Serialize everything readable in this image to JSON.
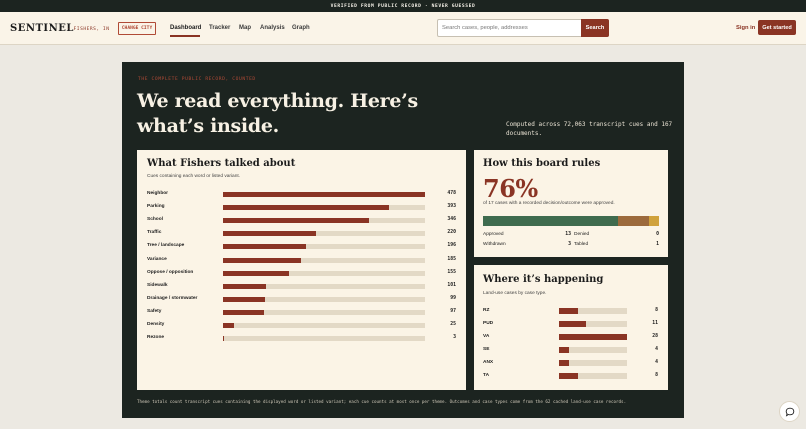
{
  "topbar": {
    "text": "VERIFIED FROM PUBLIC RECORD · NEVER GUESSED"
  },
  "header": {
    "brand": "SENTINEL",
    "city": "· FISHERS, IN",
    "change_city": "CHANGE CITY",
    "nav": [
      "Dashboard",
      "Tracker",
      "Map",
      "Analysis",
      "Graph"
    ],
    "active_nav": "Dashboard",
    "search_placeholder": "Search cases, people, addresses",
    "search_button": "Search",
    "sign_in": "Sign in",
    "get_started": "Get started"
  },
  "hero": {
    "eyebrow": "THE COMPLETE PUBLIC RECORD, COUNTED",
    "title": "We read everything. Here’s what’s inside.",
    "subtitle": "Computed across 72,063 transcript cues and 167 documents."
  },
  "topics": {
    "title": "What Fishers talked about",
    "subtitle": "Cues containing each word or listed variant.",
    "max": 478,
    "items": [
      {
        "label": "Neighbor",
        "value": 478
      },
      {
        "label": "Parking",
        "value": 393
      },
      {
        "label": "School",
        "value": 346
      },
      {
        "label": "Traffic",
        "value": 220
      },
      {
        "label": "Tree / landscape",
        "value": 196
      },
      {
        "label": "Variance",
        "value": 185
      },
      {
        "label": "Oppose / opposition",
        "value": 155
      },
      {
        "label": "Sidewalk",
        "value": 101
      },
      {
        "label": "Drainage / stormwater",
        "value": 99
      },
      {
        "label": "Safety",
        "value": 97
      },
      {
        "label": "Density",
        "value": 25
      },
      {
        "label": "Rezone",
        "value": 3
      }
    ]
  },
  "rules": {
    "title": "How this board rules",
    "percent": "76%",
    "subtitle": "of 17 cases with a recorded decision/outcome were approved.",
    "outcomes": [
      {
        "label": "Approved",
        "value": 13,
        "color": "#3f6b4e"
      },
      {
        "label": "Denied",
        "value": 0,
        "color": "#8a3424"
      },
      {
        "label": "Withdrawn",
        "value": 3,
        "color": "#9c6a3c"
      },
      {
        "label": "Tabled",
        "value": 1,
        "color": "#d0a23c"
      }
    ]
  },
  "where": {
    "title": "Where it’s happening",
    "subtitle": "Land-use cases by case type.",
    "max": 28,
    "items": [
      {
        "label": "RZ",
        "value": 8
      },
      {
        "label": "PUD",
        "value": 11
      },
      {
        "label": "VA",
        "value": 28
      },
      {
        "label": "SE",
        "value": 4
      },
      {
        "label": "ANX",
        "value": 4
      },
      {
        "label": "TA",
        "value": 8
      }
    ]
  },
  "footnote": "Theme totals count transcript cues containing the displayed word or listed variant; each cue counts at most once per theme. Outcomes and case types come from the 62 cached land-use case records.",
  "colors": {
    "brand": "#8a3424",
    "dark": "#1c2420",
    "card": "#fbf4e6",
    "track": "#e3d9c6"
  }
}
